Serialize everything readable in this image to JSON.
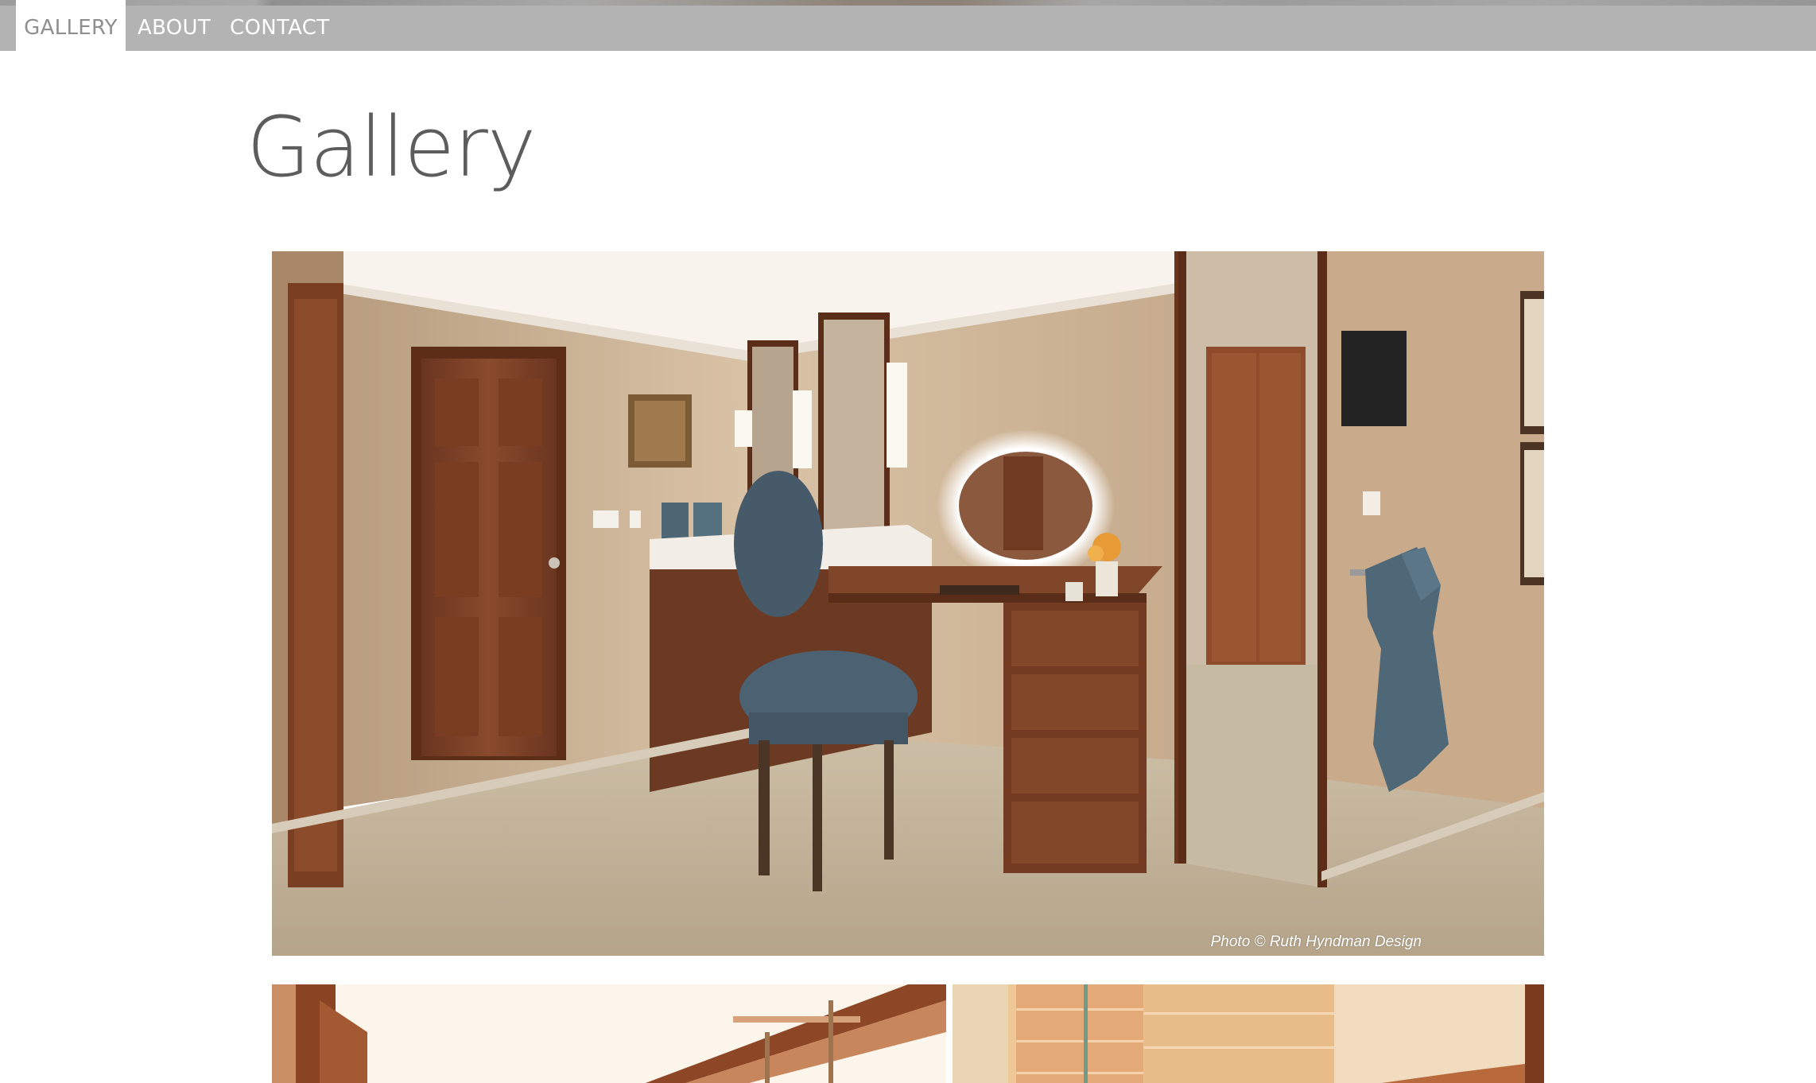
{
  "nav": {
    "items": [
      {
        "label": "GALLERY",
        "active": true
      },
      {
        "label": "ABOUT",
        "active": false
      },
      {
        "label": "CONTACT",
        "active": false
      }
    ]
  },
  "page": {
    "title": "Gallery"
  },
  "gallery": {
    "main_photo": {
      "credit": "Photo © Ruth Hyndman Design"
    }
  },
  "colors": {
    "nav_bg": "#b3b3b3",
    "nav_active_bg": "#ffffff",
    "nav_active_text": "#8f8f8f",
    "title_text": "#5d5d5d"
  }
}
